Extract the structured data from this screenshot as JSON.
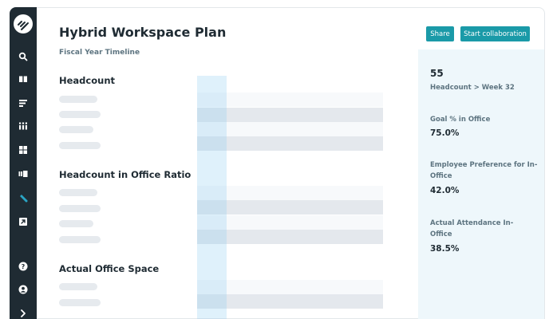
{
  "app": {
    "title": "Hybrid Workspace Plan",
    "subtitle": "Fiscal Year Timeline"
  },
  "sidebar": {
    "logo_icon": "logo-icon",
    "items": [
      {
        "icon": "search-icon",
        "active": false
      },
      {
        "icon": "book-icon",
        "active": false
      },
      {
        "icon": "list-icon",
        "active": false
      },
      {
        "icon": "grid-dots-icon",
        "active": false
      },
      {
        "icon": "dashboard-icon",
        "active": false
      },
      {
        "icon": "columns-icon",
        "active": false
      },
      {
        "icon": "pen-icon",
        "active": true
      },
      {
        "icon": "external-link-icon",
        "active": false
      }
    ],
    "bottom": [
      {
        "icon": "help-icon"
      },
      {
        "icon": "user-icon"
      },
      {
        "icon": "chevron-right-icon"
      }
    ]
  },
  "toolbar": {
    "share_label": "Share",
    "collab_label": "Start collaboration"
  },
  "sections": [
    {
      "title": "Headcount",
      "rows": 4
    },
    {
      "title": "Headcount in Office Ratio",
      "rows": 4
    },
    {
      "title": "Actual Office Space",
      "rows": 2
    }
  ],
  "stats": [
    {
      "value": "55",
      "label": "Headcount > Week 32"
    },
    {
      "label": "Goal % in Office",
      "value": "75.0%"
    },
    {
      "label": "Employee Preference for In-Office",
      "value": "42.0%"
    },
    {
      "label": "Actual Attendance In-Office",
      "value": "38.5%"
    }
  ],
  "colors": {
    "sidebar": "#1f2b33",
    "accent": "#1a9aa8",
    "active_icon": "#2aa4c4",
    "panel": "#eef7fb"
  }
}
